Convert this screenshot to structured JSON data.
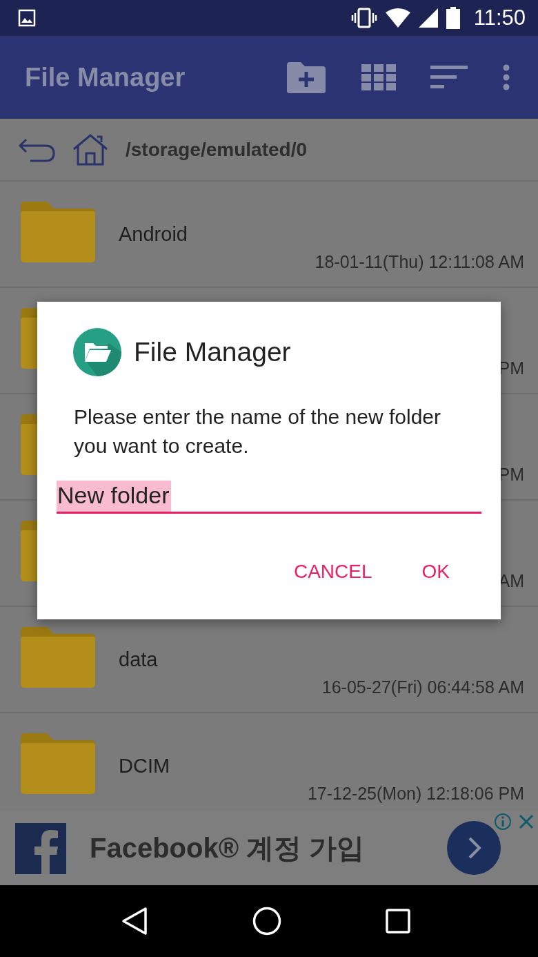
{
  "status_bar": {
    "time": "11:50"
  },
  "app_bar": {
    "title": "File Manager"
  },
  "path_bar": {
    "path": "/storage/emulated/0"
  },
  "files": [
    {
      "name": "Android",
      "date": "18-01-11(Thu) 12:11:08 AM"
    },
    {
      "date": "PM"
    },
    {
      "date": "PM"
    },
    {
      "date": "AM"
    },
    {
      "name": "data",
      "date": "16-05-27(Fri) 06:44:58 AM"
    },
    {
      "name": "DCIM",
      "date": "17-12-25(Mon) 12:18:06 PM"
    }
  ],
  "dialog": {
    "title": "File Manager",
    "message": "Please enter the name of the new folder you want to create.",
    "field": {
      "value": "New folder",
      "selected": true
    },
    "buttons": [
      "CANCEL",
      "OK"
    ]
  },
  "ad": {
    "text": "Facebook® 계정 가입"
  }
}
